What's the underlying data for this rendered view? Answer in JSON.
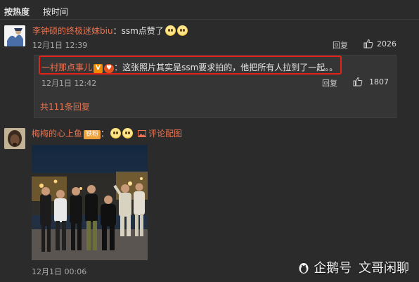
{
  "sort_tabs": {
    "hot": "按热度",
    "time": "按时间"
  },
  "comment1": {
    "username": "李钟硕的终极迷妹biu",
    "text": "：ssm点赞了",
    "time": "12月1日 12:39",
    "reply_label": "回复",
    "likes": "2026"
  },
  "reply": {
    "username": "一村那点事儿",
    "verified_badge": "V",
    "text": "：这张照片其实是ssm要求拍的，他把所有人拉到了一起。。",
    "time": "12月1日 12:42",
    "reply_label": "回复",
    "likes": "1807"
  },
  "reply_summary": "共111条回复",
  "comment2": {
    "username": "梅梅的心上鱼",
    "fan_badge": "铁粉",
    "text": "：",
    "image_label": "评论配图",
    "time": "12月1日 00:06"
  },
  "watermark": {
    "logo_text": "企鹅号",
    "author": "文哥闲聊"
  },
  "colors": {
    "background": "#2b2b2b",
    "username": "#eb7350",
    "highlight_border": "#e2231a"
  }
}
